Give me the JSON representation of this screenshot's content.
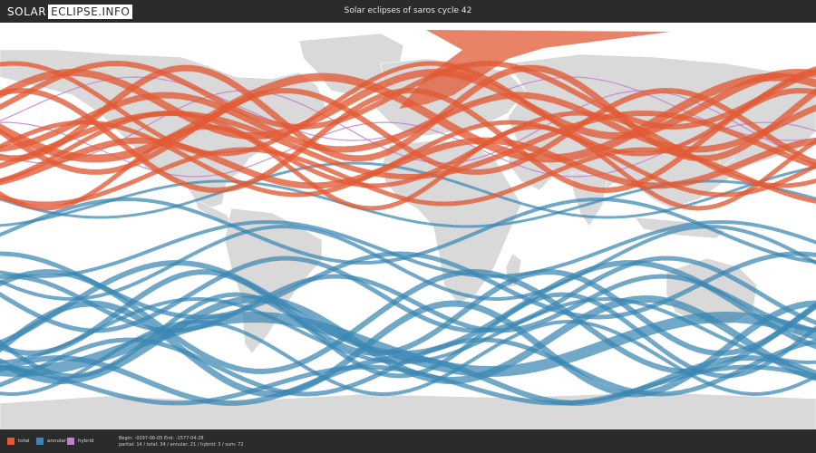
{
  "header": {
    "logo_part1": "SOLAR",
    "logo_part2": "ECLIPSE.INFO",
    "title": "Solar eclipses of saros cycle 42"
  },
  "colors": {
    "total": "#e25a35",
    "annular": "#3a87b3",
    "hybrid": "#c07fcf",
    "land": "#d9d9d9",
    "ocean": "#ffffff"
  },
  "legend": [
    {
      "key": "total",
      "label": "total"
    },
    {
      "key": "annular",
      "label": "annular"
    },
    {
      "key": "hybrid",
      "label": "hybrid"
    }
  ],
  "footer": {
    "line1": "Begin: -0297-06-05 End: -1577-04-28",
    "line2": "partial: 14 / total: 34 / annular: 21 / hybrid: 3 / sum: 72"
  }
}
